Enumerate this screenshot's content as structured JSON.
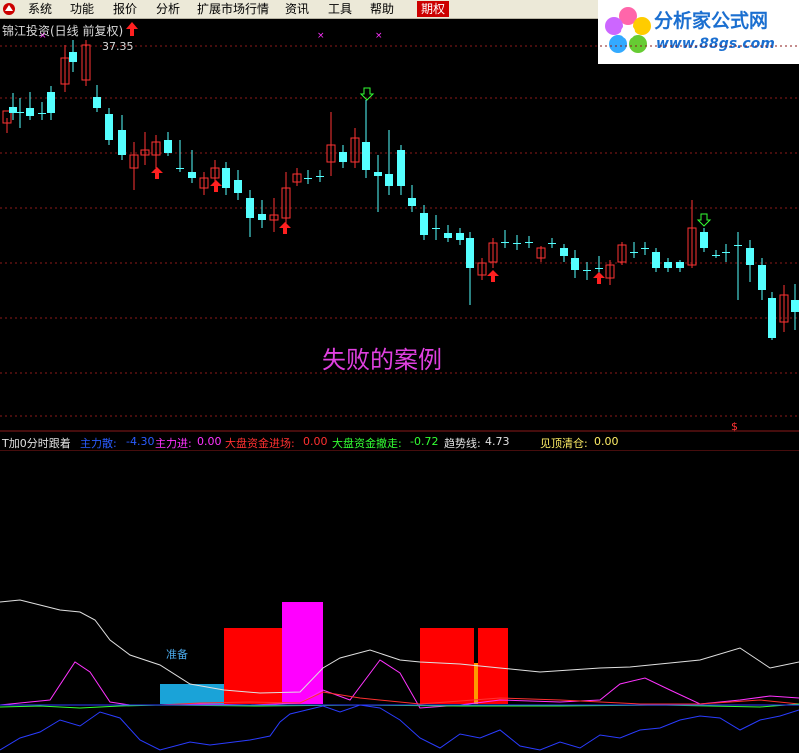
{
  "menu": {
    "items": [
      "系统",
      "功能",
      "报价",
      "分析",
      "扩展市场行情",
      "资讯",
      "工具",
      "帮助"
    ],
    "active": "期权"
  },
  "brand": {
    "name": "分析家公式网",
    "url": "www.88gs.com"
  },
  "chart": {
    "title": "锦江投资(日线 前复权)",
    "high_label": "37.35",
    "caption": "失败的案例",
    "signal_symbol": "$"
  },
  "indicator": {
    "name": "T加0分时跟着",
    "items": [
      {
        "label": "主力散:",
        "value": "-4.30",
        "color": "#2a5cff"
      },
      {
        "label": "主力进:",
        "value": "0.00",
        "color": "#ff33ff"
      },
      {
        "label": "大盘资金进场:",
        "value": "0.00",
        "color": "#ff3030"
      },
      {
        "label": "大盘资金撤走:",
        "value": "-0.72",
        "color": "#33ff33"
      },
      {
        "label": "趋势线:",
        "value": "4.73",
        "color": "#e0e0e0"
      },
      {
        "label": "见顶清仓:",
        "value": "0.00",
        "color": "#ffee66"
      }
    ],
    "ready_label": "准备"
  },
  "colors": {
    "up": "#ff3333",
    "down": "#55ffff",
    "grid": "#8b1a1a",
    "caption": "#e040e0"
  }
}
